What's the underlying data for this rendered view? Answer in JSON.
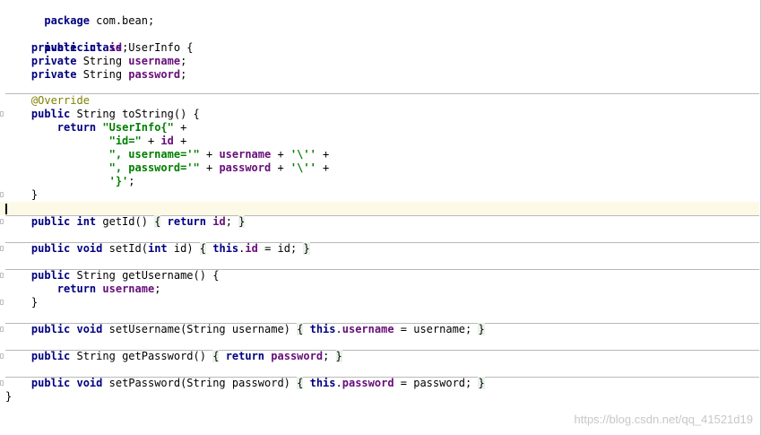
{
  "code": {
    "package_kw": "package",
    "package_name": " com.bean;",
    "class_decl_kw": "public class",
    "class_name": " UserInfo {",
    "field_id_kw": "private int",
    "field_id": "id",
    "field_username_kw": "private",
    "field_username_type": " String ",
    "field_username": "username",
    "field_password_kw": "private",
    "field_password_type": " String ",
    "field_password": "password",
    "annotation": "@Override",
    "tostring_kw": "public",
    "tostring_sig": " String toString() {",
    "return_kw": "return",
    "tostring_str1": "\"UserInfo{\"",
    "tostring_str2": "\"id=\"",
    "tostring_str3": "\", username='\"",
    "tostring_str4": "\", password='\"",
    "tostring_str5": "'}'",
    "getid_kw": "public int",
    "getid_name": " getId() ",
    "getid_body_kw": "return",
    "getid_field": "id",
    "setid_kw": "public void",
    "setid_name": " setId(",
    "setid_param_kw": "int",
    "setid_param": " id) ",
    "setid_this": "this",
    "setid_field": "id",
    "setid_assign": " = id; ",
    "getusername_kw": "public",
    "getusername_sig": " String getUsername() {",
    "getusername_return_kw": "return",
    "getusername_field": "username",
    "setusername_kw": "public void",
    "setusername_name": " setUsername(String username) ",
    "setusername_this": "this",
    "setusername_field": "username",
    "setusername_assign": " = username; ",
    "getpassword_kw": "public",
    "getpassword_sig": " String getPassword() ",
    "getpassword_return_kw": "return",
    "getpassword_field": "password",
    "setpassword_kw": "public void",
    "setpassword_name": " setPassword(String password) ",
    "setpassword_this": "this",
    "setpassword_field": "password",
    "setpassword_assign": " = password; "
  },
  "watermark": "https://blog.csdn.net/qq_41521d19",
  "colors": {
    "keyword": "#000080",
    "field": "#660e7a",
    "string": "#008000",
    "annotation": "#808000",
    "current_line": "#fcf9e6"
  }
}
